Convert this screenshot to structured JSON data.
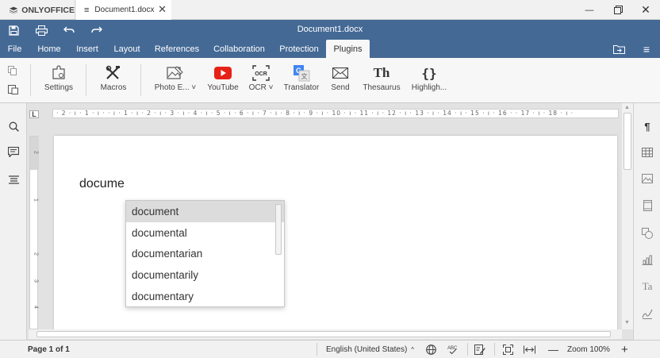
{
  "app": {
    "brand": "ONLYOFFICE",
    "tab_label": "Document1.docx",
    "window_title": "Document1.docx"
  },
  "menu": [
    {
      "label": "File"
    },
    {
      "label": "Home"
    },
    {
      "label": "Insert"
    },
    {
      "label": "Layout"
    },
    {
      "label": "References"
    },
    {
      "label": "Collaboration"
    },
    {
      "label": "Protection"
    },
    {
      "label": "Plugins",
      "active": true
    }
  ],
  "toolbar": {
    "settings": "Settings",
    "macros": "Macros",
    "photo_editor": "Photo E...",
    "youtube": "YouTube",
    "ocr": "OCR",
    "translator": "Translator",
    "send": "Send",
    "thesaurus": "Thesaurus",
    "highlight_code": "Highligh..."
  },
  "document": {
    "typed_text": "docume"
  },
  "autocomplete": {
    "items": [
      "document",
      "documental",
      "documentarian",
      "documentarily",
      "documentary"
    ],
    "selected_index": 0
  },
  "ruler": {
    "labels": "· 2 · ı · 1 · ı ·   · ı · 1 · ı · 2 · ı · 3 · ı · 4 · ı · 5 · ı · 6 · ı · 7 · ı · 8 · ı · 9 · ı · 10 · ı · 11 · ı · 12 · ı · 13 · ı · 14 · ı · 15 · ı · 16 ·   · 17 · ı · 18 · ı ·"
  },
  "status": {
    "page": "Page 1 of 1",
    "language": "English (United States)",
    "zoom": "Zoom 100%"
  },
  "colors": {
    "header_blue": "#446995",
    "youtube_red": "#e62117",
    "translator_blue": "#4285f4"
  }
}
